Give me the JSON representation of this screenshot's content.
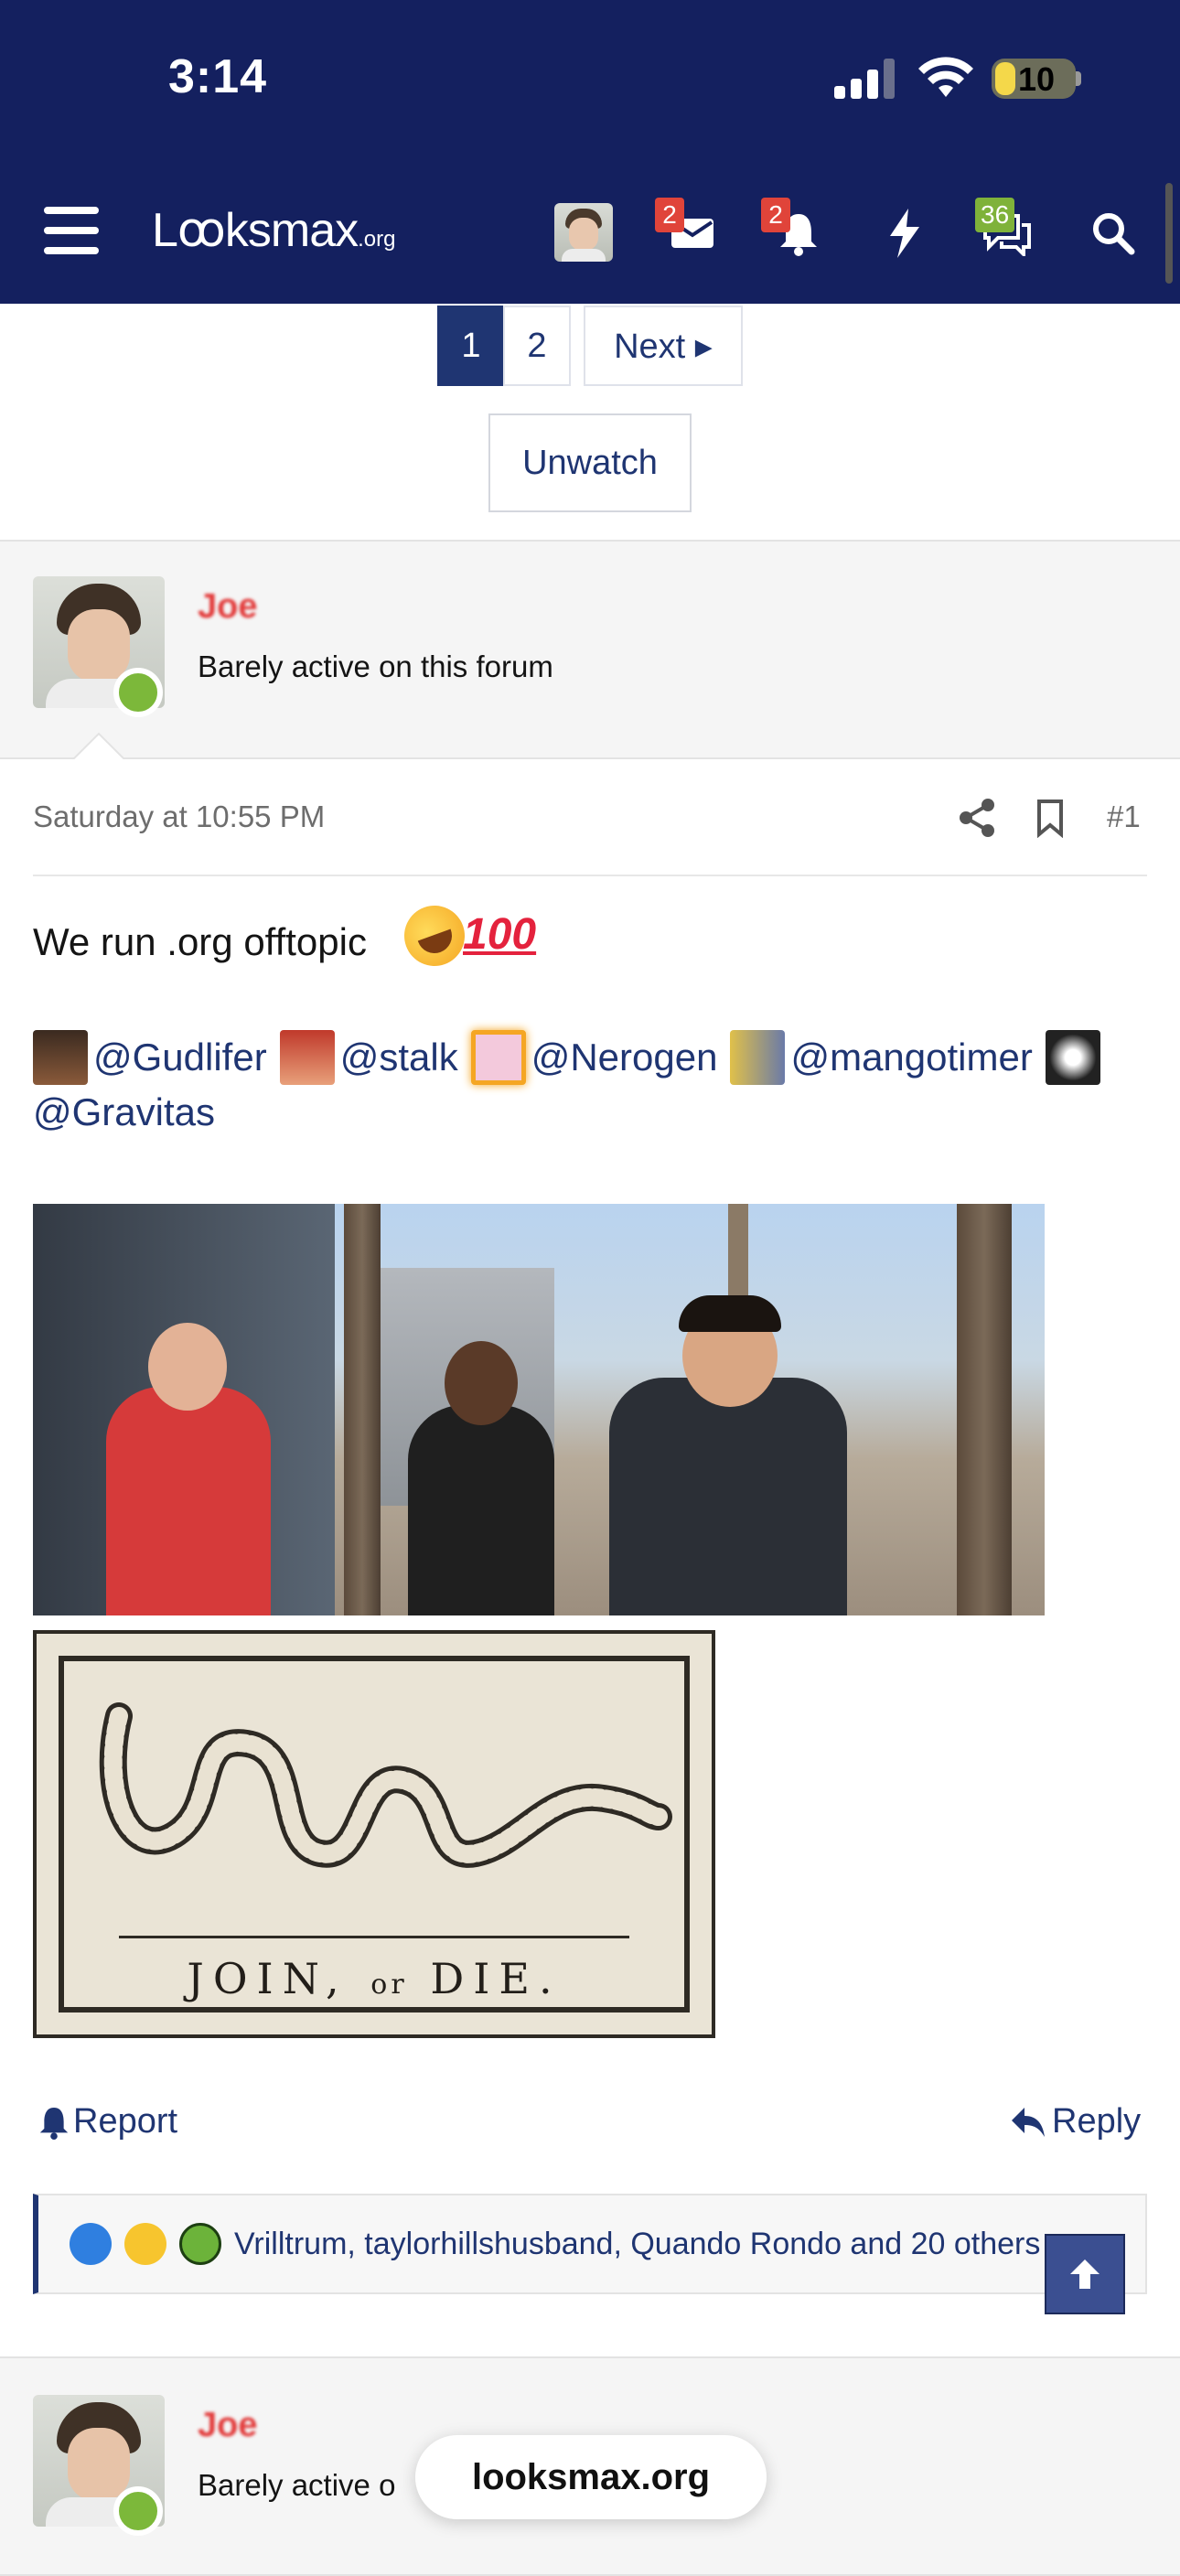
{
  "status_bar": {
    "time": "3:14",
    "battery": "10"
  },
  "header": {
    "logo_main": "Lꝏksmax",
    "logo_suffix": ".org",
    "badges": {
      "inbox": "2",
      "alerts": "2",
      "whats_new": "36"
    },
    "accent_color": "#14205f"
  },
  "pagination": {
    "pages": [
      "1",
      "2"
    ],
    "next_label": "Next ▸",
    "current": "1"
  },
  "unwatch_label": "Unwatch",
  "post": {
    "username": "Joe",
    "user_title": "Barely active on this forum",
    "date": "Saturday at 10:55 PM",
    "number": "#1",
    "text": "We run .org offtopic",
    "emoji_100": "100",
    "mentions": [
      "@Gudlifer",
      "@stalk",
      "@Nerogen",
      "@mangotimer",
      "@Gravitas"
    ],
    "flag_caption_a": "JOIN,",
    "flag_caption_b": "or",
    "flag_caption_c": "DIE.",
    "report_label": "Report",
    "reply_label": "Reply",
    "reactions_text": "Vrilltrum, taylorhillshusband, Quando Rondo and 20 others"
  },
  "next_post": {
    "username": "Joe",
    "user_title_partial": "Barely active o"
  },
  "browser": {
    "domain": "looksmax.org"
  }
}
